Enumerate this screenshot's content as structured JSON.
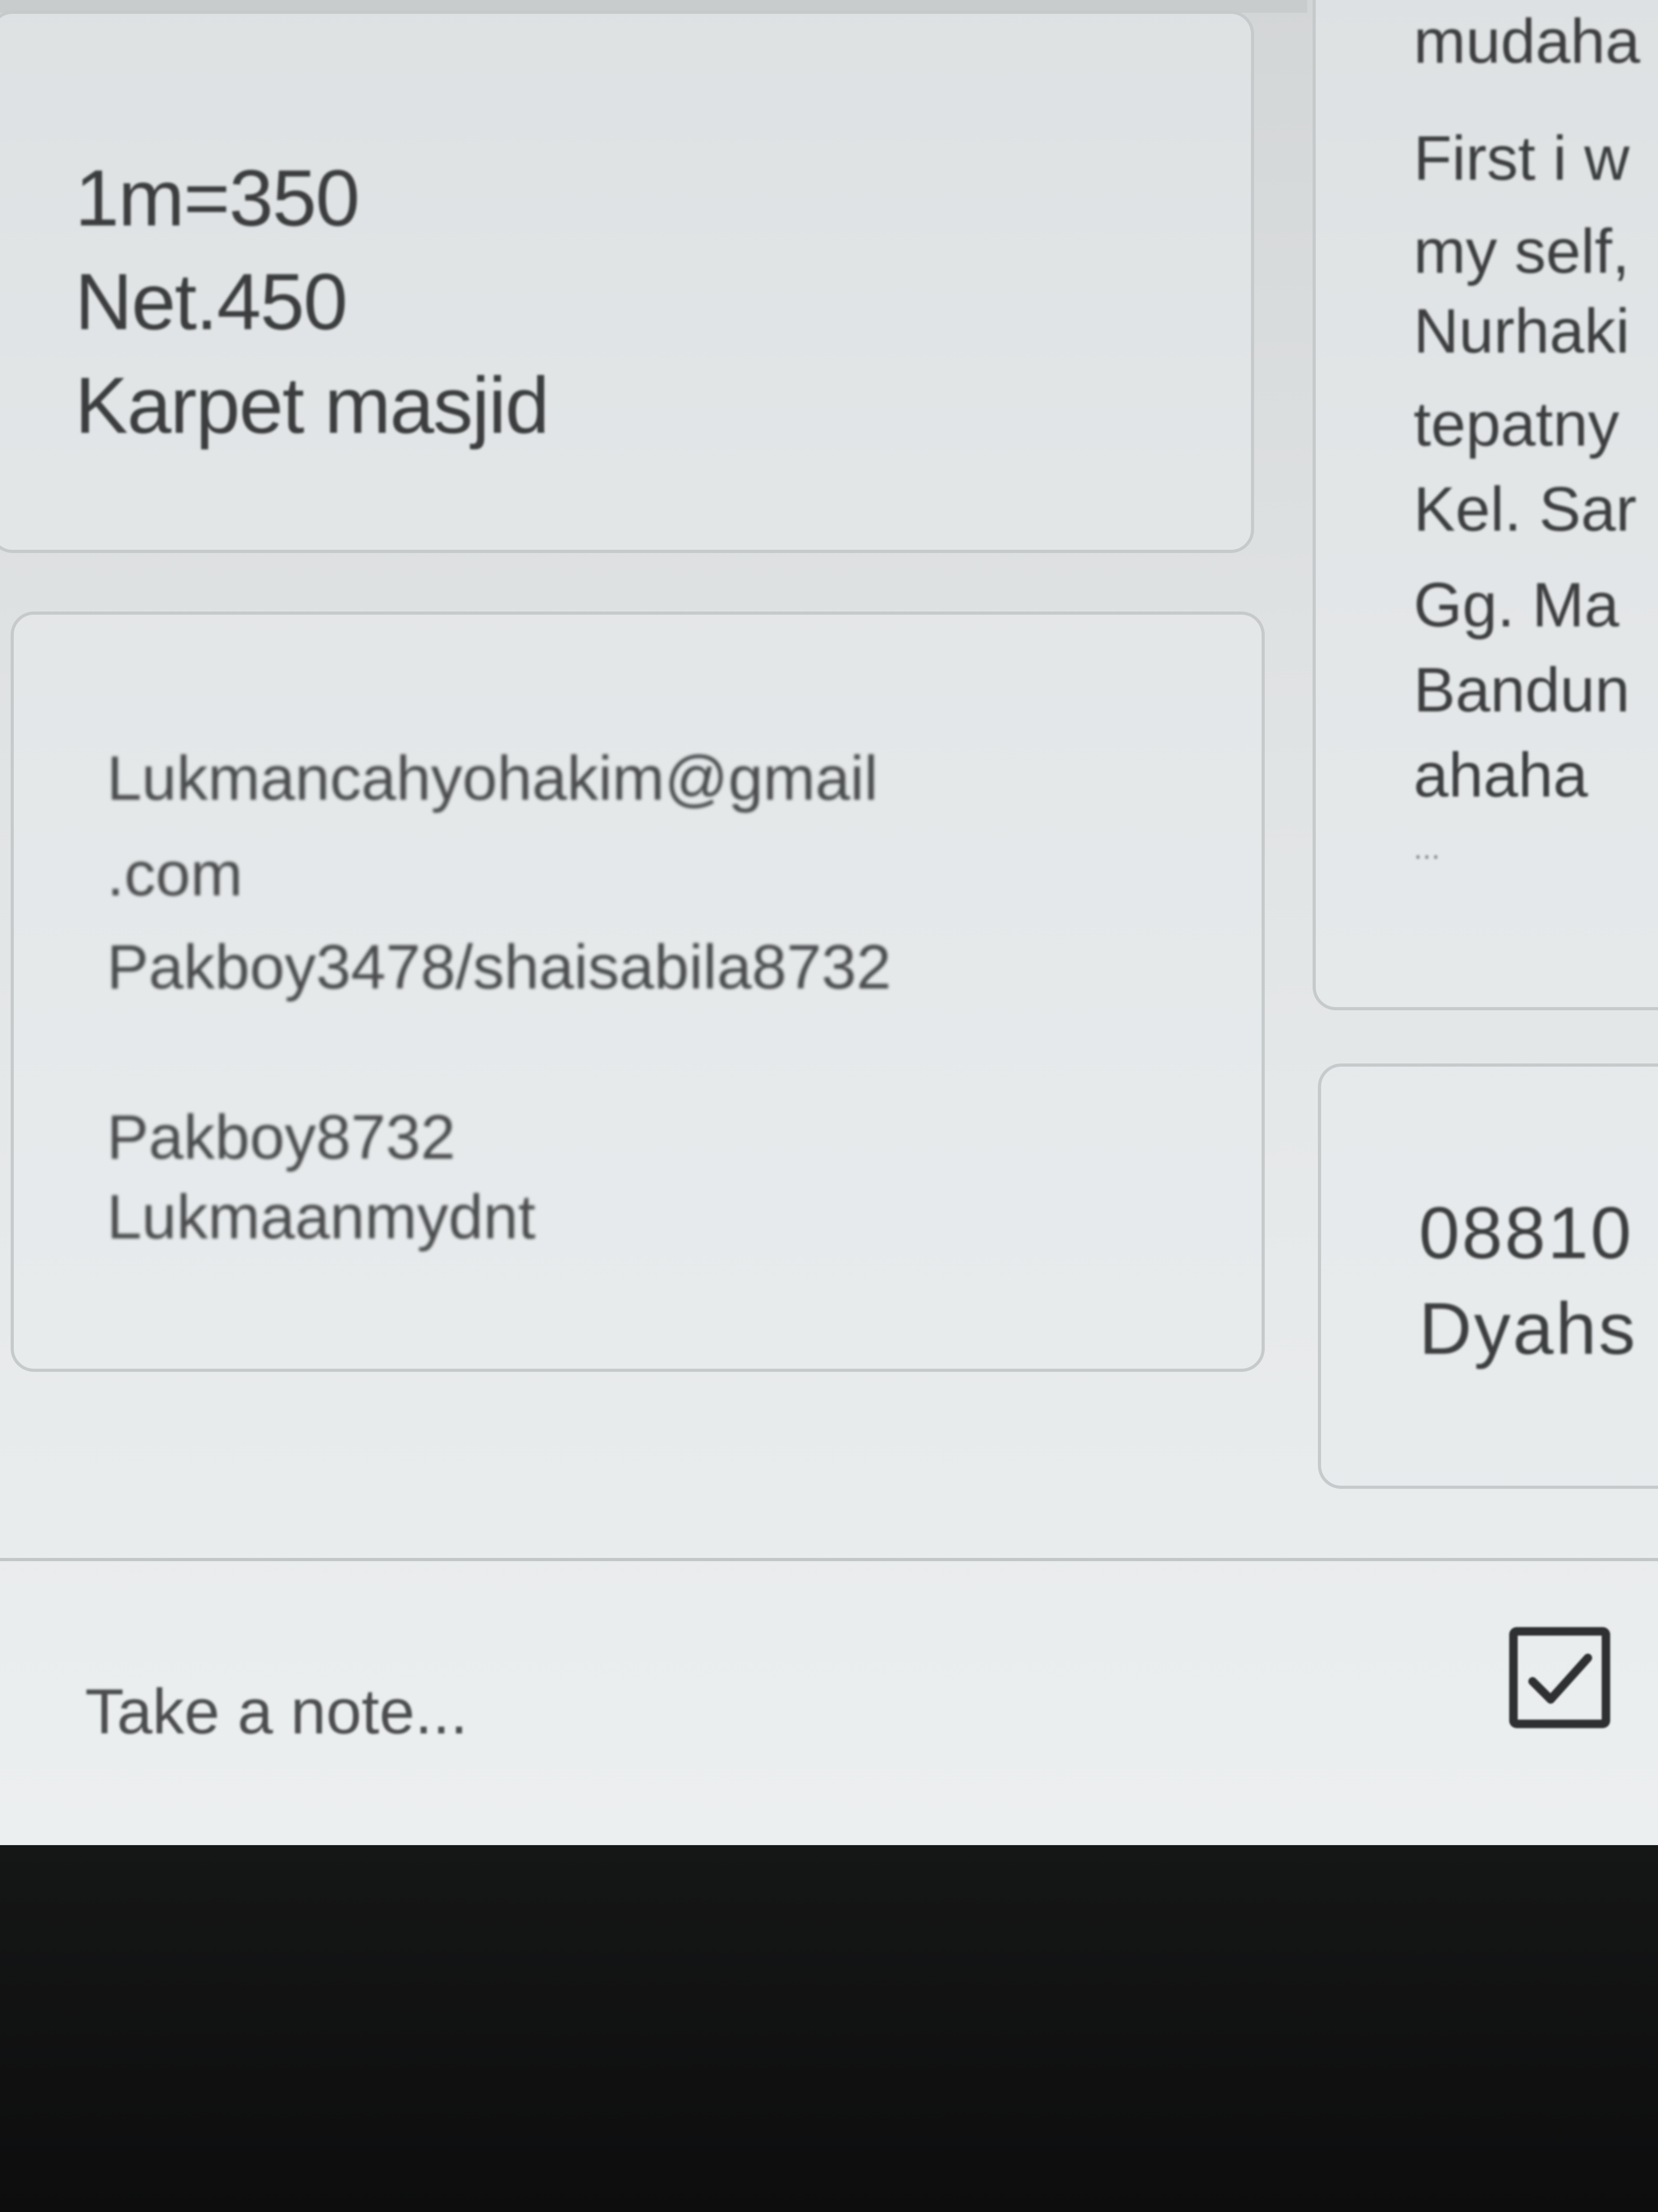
{
  "notes": [
    {
      "lines": [
        "1m=350",
        "Net.450",
        "Karpet masjid"
      ]
    },
    {
      "lines": [
        "Lukmancahyohakim@gmail",
        ".com",
        "Pakboy3478/shaisabila8732",
        "",
        "Pakboy8732",
        "Lukmaanmydnt"
      ]
    },
    {
      "lines": [
        "mudaha",
        "First i w",
        "my self,",
        "Nurhaki",
        "tepatny",
        "Kel. Sar",
        "Gg. Ma",
        "Bandun",
        "ahaha",
        "..."
      ]
    },
    {
      "lines": [
        "08810",
        "Dyahs"
      ]
    }
  ],
  "composer": {
    "placeholder": "Take a note...",
    "checkbox_icon": "checkbox-icon"
  }
}
